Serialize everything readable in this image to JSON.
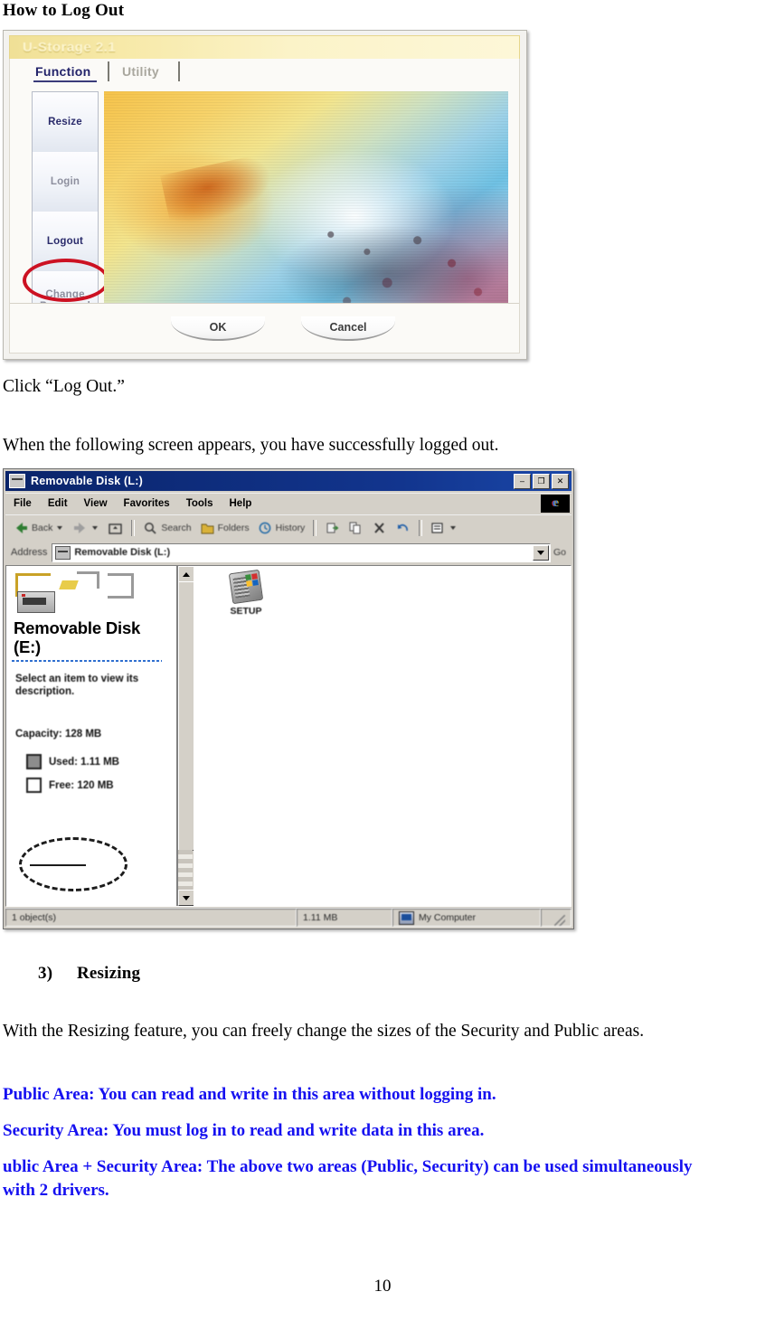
{
  "document": {
    "heading": "How to Log Out",
    "caption_click": "Click  “Log Out.”",
    "caption_logged_out": "When the following screen appears, you have successfully logged out.",
    "section_number": "3)",
    "section_title": "Resizing",
    "paragraph_resizing": "With the Resizing feature, you can freely change the sizes of the Security and Public areas.",
    "note_public": "Public Area: You can read and write in this area without logging in.",
    "note_security": "Security Area: You must log in to read and write data in this area.",
    "note_combined": "ublic Area + Security Area: The above two areas (Public, Security) can be used simultaneously with 2 drivers.",
    "page_number": "10",
    "note_color": "#1510f0"
  },
  "ustorage_window": {
    "title": "U-Storage 2.1",
    "tabs": [
      {
        "label": "Function",
        "active": true
      },
      {
        "label": "Utility",
        "active": false
      }
    ],
    "sidebar_buttons": [
      {
        "label": "Resize",
        "highlighted": false
      },
      {
        "label": "Login",
        "highlighted": false
      },
      {
        "label": "Logout",
        "highlighted": true
      },
      {
        "label": "Change Password",
        "highlighted": false
      }
    ],
    "highlight_color": "#cc1122",
    "footer_buttons": [
      {
        "label": "OK"
      },
      {
        "label": "Cancel"
      }
    ]
  },
  "explorer_window": {
    "title": "Removable Disk (L:)",
    "window_buttons": [
      "–",
      "❐",
      "✕"
    ],
    "menus": [
      "File",
      "Edit",
      "View",
      "Favorites",
      "Tools",
      "Help"
    ],
    "toolbar": [
      {
        "label": "Back",
        "icon": "back-arrow-icon"
      },
      {
        "label": "Forward",
        "icon": "forward-arrow-icon"
      },
      {
        "label": "Up",
        "icon": "up-folder-icon"
      },
      {
        "label": "Search",
        "icon": "search-icon"
      },
      {
        "label": "Folders",
        "icon": "folders-icon"
      },
      {
        "label": "History",
        "icon": "history-icon"
      },
      {
        "label": "Move To",
        "icon": "move-to-icon"
      },
      {
        "label": "Copy To",
        "icon": "copy-to-icon"
      },
      {
        "label": "Delete",
        "icon": "delete-icon"
      },
      {
        "label": "Undo",
        "icon": "undo-icon"
      },
      {
        "label": "Views",
        "icon": "views-icon"
      }
    ],
    "address": {
      "label": "Address",
      "value": "Removable Disk (L:)",
      "go_label": "Go"
    },
    "left_panel": {
      "drive_name": "Removable Disk (E:)",
      "description": "Select an item to view its description.",
      "capacity": "Capacity: 128 MB",
      "used": "Used: 1.11 MB",
      "free": "Free: 120 MB"
    },
    "files": [
      {
        "name": "SETUP",
        "icon": "setup-installer-icon"
      }
    ],
    "status_bar": {
      "objects": "1 object(s)",
      "size": "1.11 MB",
      "location": "My Computer"
    }
  }
}
